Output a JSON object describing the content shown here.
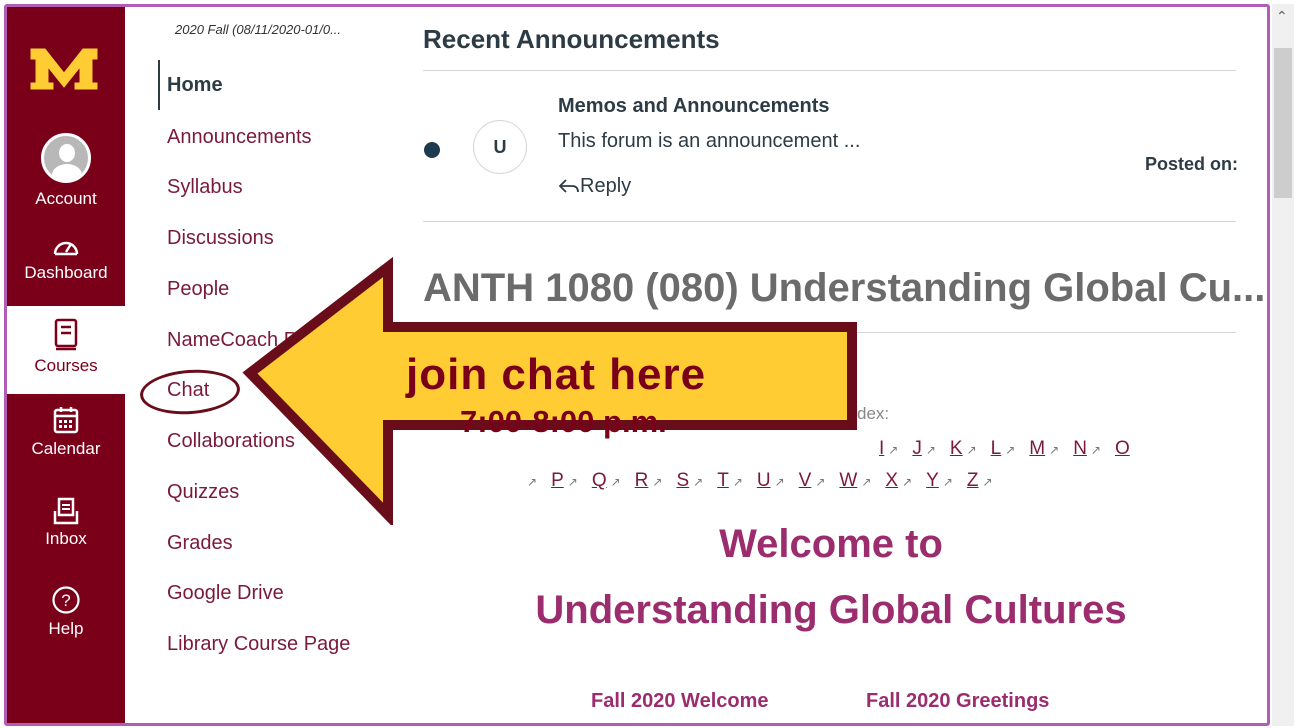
{
  "global_nav": {
    "account": "Account",
    "dashboard": "Dashboard",
    "courses": "Courses",
    "calendar": "Calendar",
    "inbox": "Inbox",
    "help": "Help"
  },
  "course_nav": {
    "term": "2020 Fall (08/11/2020-01/0...",
    "items": [
      "Home",
      "Announcements",
      "Syllabus",
      "Discussions",
      "People",
      "NameCoach Re",
      "Chat",
      "Collaborations",
      "Quizzes",
      "Grades",
      "Google Drive",
      "Library Course Page"
    ]
  },
  "main": {
    "recent_heading": "Recent Announcements",
    "announcement": {
      "avatar_initial": "U",
      "title": "Memos and Announcements",
      "text": "This forum is an announcement ...",
      "reply": "Reply",
      "posted": "Posted on:"
    },
    "course_title": "ANTH 1080 (080) Understanding Global Cu...",
    "index_fragment": "dex:",
    "letters_row1": [
      "I",
      "J",
      "K",
      "L",
      "M",
      "N",
      "O"
    ],
    "letters_row2": [
      "P",
      "Q",
      "R",
      "S",
      "T",
      "U",
      "V",
      "W",
      "X",
      "Y",
      "Z"
    ],
    "welcome_line1": "Welcome to",
    "welcome_line2": "Understanding Global Cultures",
    "link_welcome": "Fall 2020  Welcome",
    "link_greetings": "Fall 2020 Greetings"
  },
  "callout": {
    "line1": "join chat here",
    "line2": "7:00-8:00 p.m."
  },
  "colors": {
    "maroon": "#7a0019",
    "gold": "#ffcc33",
    "link": "#9b2d6e",
    "frame": "#b25db5"
  }
}
